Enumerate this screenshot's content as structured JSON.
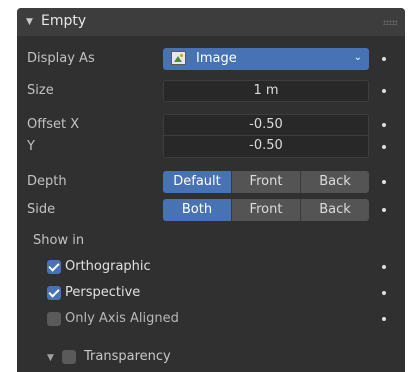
{
  "header": {
    "title": "Empty"
  },
  "display_as": {
    "label": "Display As",
    "value": "Image",
    "icon": "image-icon"
  },
  "size": {
    "label": "Size",
    "value": "1 m"
  },
  "offset_x": {
    "label": "Offset X",
    "value": "-0.50"
  },
  "offset_y": {
    "label": "Y",
    "value": "-0.50"
  },
  "depth": {
    "label": "Depth",
    "options": [
      "Default",
      "Front",
      "Back"
    ],
    "selected": "Default"
  },
  "side": {
    "label": "Side",
    "options": [
      "Both",
      "Front",
      "Back"
    ],
    "selected": "Both"
  },
  "show_in": {
    "label": "Show in",
    "orthographic": {
      "label": "Orthographic",
      "checked": true
    },
    "perspective": {
      "label": "Perspective",
      "checked": true
    },
    "only_axis_aligned": {
      "label": "Only Axis Aligned",
      "checked": false
    }
  },
  "transparency": {
    "label": "Transparency",
    "checked": false
  },
  "colors": {
    "accent": "#4772b3",
    "panel": "#303030",
    "header": "#3d3d3d"
  }
}
